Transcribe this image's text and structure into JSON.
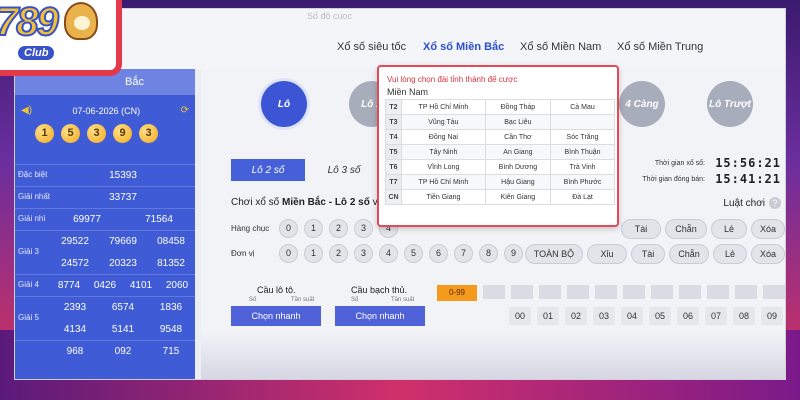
{
  "topbar": {
    "faint_left": "",
    "faint_right": "Số độ cuoc"
  },
  "nav": {
    "tabs": [
      {
        "label": "Xổ số siêu tốc",
        "active": false
      },
      {
        "label": "Xổ số Miền Bắc",
        "active": true
      },
      {
        "label": "Xổ số Miền Nam",
        "active": false
      },
      {
        "label": "Xổ số Miền Trung",
        "active": false
      }
    ]
  },
  "logo": {
    "number": "789",
    "club": "Club"
  },
  "left_panel": {
    "header": "Bắc",
    "date": "07-06-2026 (CN)",
    "balls": [
      "1",
      "5",
      "3",
      "9",
      "3"
    ],
    "results": [
      {
        "label": "Đặc biệt",
        "values": [
          "15393"
        ]
      },
      {
        "label": "Giải nhất",
        "values": [
          "33737"
        ]
      },
      {
        "label": "Giải nhì",
        "values": [
          "69977",
          "71564"
        ]
      },
      {
        "label": "Giải 3",
        "values": [
          "29522",
          "79669",
          "08458",
          "24572",
          "20323",
          "81352"
        ]
      },
      {
        "label": "Giải 4",
        "values": [
          "8774",
          "0426",
          "4101",
          "2060"
        ]
      },
      {
        "label": "Giải 5",
        "values": [
          "2393",
          "6574",
          "1836",
          "4134",
          "5141",
          "9548"
        ]
      },
      {
        "label": "",
        "values": [
          "968",
          "092",
          "715"
        ]
      }
    ]
  },
  "main": {
    "circles": [
      {
        "label": "Lô",
        "active": true
      },
      {
        "label": "Lô X",
        "active": false
      },
      {
        "label": "4 Càng",
        "active": false
      },
      {
        "label": "Lô Trượt",
        "active": false
      }
    ],
    "subtabs": {
      "active": "Lô 2 số",
      "other": "Lô 3 số"
    },
    "timer": {
      "draw_label": "Thời gian xổ số:",
      "draw_value": "15:56:21",
      "close_label": "Thời gian đóng bán:",
      "close_value": "15:41:21"
    },
    "game_title_prefix": "Chơi xổ số ",
    "game_title_bold": "Miền Bắc - Lô 2 số",
    "game_title_suffix": " với t",
    "rules_label": "Luật chơi",
    "rules_icon": "question-icon",
    "rows": [
      {
        "label": "Hàng chục",
        "digits": [
          "0",
          "1",
          "2",
          "3",
          "4"
        ],
        "actions": [
          "Tài",
          "Chẵn",
          "Lẻ",
          "Xóa"
        ]
      },
      {
        "label": "Đơn vị",
        "digits": [
          "0",
          "1",
          "2",
          "3",
          "4",
          "5",
          "6",
          "7",
          "8",
          "9"
        ],
        "actions": [
          "TOÀN BỘ",
          "Xỉu",
          "Tài",
          "Chẵn",
          "Lẻ",
          "Xóa"
        ]
      }
    ],
    "cau_lo_to": {
      "title": "Cầu lô tô.",
      "sub_a": "Số",
      "sub_b": "Tần suất",
      "button": "Chọn nhanh"
    },
    "cau_bach_thu": {
      "title": "Cầu bạch thủ.",
      "sub_a": "Số",
      "sub_b": "Tần suất",
      "button": "Chọn nhanh"
    },
    "range_label": "0-99",
    "grid_numbers": [
      "00",
      "01",
      "02",
      "03",
      "04",
      "05",
      "06",
      "07",
      "08",
      "09"
    ]
  },
  "dropdown": {
    "prompt": "Vui lòng chọn đài tỉnh thành để cược",
    "region": "Miền Nam",
    "rows": [
      {
        "day": "T2",
        "cells": [
          "TP Hồ Chí Minh",
          "Đồng Tháp",
          "Cà Mau"
        ]
      },
      {
        "day": "T3",
        "cells": [
          "Vũng Tàu",
          "Bạc Liêu",
          ""
        ]
      },
      {
        "day": "T4",
        "cells": [
          "Đồng Nai",
          "Cần Thơ",
          "Sóc Trăng"
        ]
      },
      {
        "day": "T5",
        "cells": [
          "Tây Ninh",
          "An Giang",
          "Bình Thuận"
        ]
      },
      {
        "day": "T6",
        "cells": [
          "Vĩnh Long",
          "Bình Dương",
          "Trà Vinh"
        ]
      },
      {
        "day": "T7",
        "cells": [
          "TP Hồ Chí Minh",
          "Hậu Giang",
          "Bình Phước"
        ]
      },
      {
        "day": "CN",
        "cells": [
          "Tiền Giang",
          "Kiên Giang",
          "Đà Lạt"
        ]
      }
    ]
  }
}
